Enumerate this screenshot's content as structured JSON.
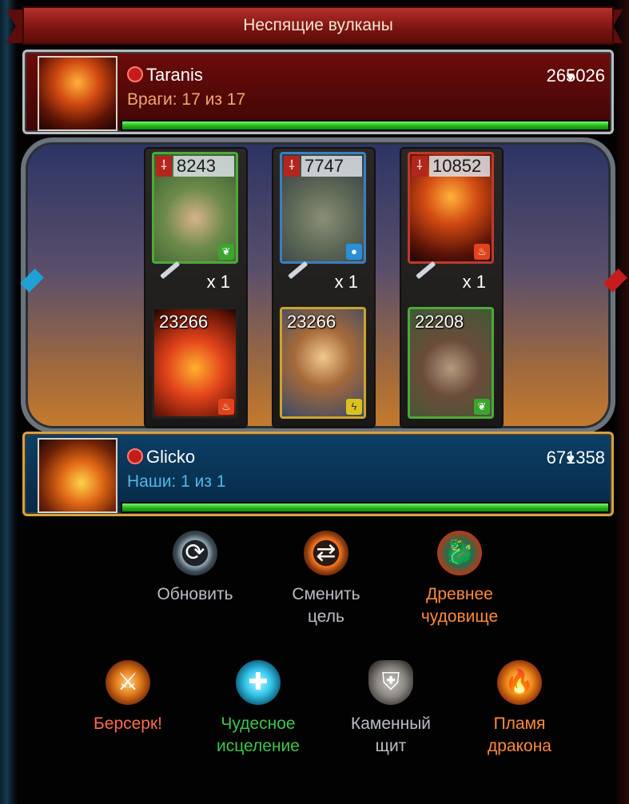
{
  "header": {
    "title": "Неспящие вулканы"
  },
  "enemy": {
    "name": "Taranis",
    "stat": "Враги: 17 из 17",
    "hp": "265026",
    "hp_fraction": 1.0
  },
  "ally": {
    "name": "Glicko",
    "stat": "Наши: 1 из 1",
    "hp": "671358",
    "hp_fraction": 1.0
  },
  "battles": [
    {
      "enemy_power": "8243",
      "enemy_element": "leaf",
      "multiplier": "x 1",
      "ally_power": "23266",
      "ally_element": "fire"
    },
    {
      "enemy_power": "7747",
      "enemy_element": "water",
      "multiplier": "x 1",
      "ally_power": "23266",
      "ally_element": "lightning"
    },
    {
      "enemy_power": "10852",
      "enemy_element": "fire",
      "multiplier": "x 1",
      "ally_power": "22208",
      "ally_element": "leaf"
    }
  ],
  "actions": {
    "refresh": "Обновить",
    "change_target_1": "Сменить",
    "change_target_2": "цель",
    "ancient_monster_1": "Древнее",
    "ancient_monster_2": "чудовище",
    "berserk": "Берсерк!",
    "heal_1": "Чудесное",
    "heal_2": "исцеление",
    "stone_shield_1": "Каменный",
    "stone_shield_2": "щит",
    "dragon_flame_1": "Пламя",
    "dragon_flame_2": "дракона"
  },
  "colors": {
    "enemy_bar": "#6d0c0a",
    "ally_bar": "#0c3f66",
    "hp_green": "#24b51b",
    "element_fire": "#e2431b",
    "element_water": "#2a8fd6",
    "element_leaf": "#3aa62d",
    "element_lightning": "#d9c21e"
  },
  "icons": {
    "element_leaf": "leaf-icon",
    "element_water": "water-drop-icon",
    "element_fire": "fire-icon",
    "element_lightning": "lightning-icon",
    "heart": "heart-icon",
    "sword": "sword-icon"
  }
}
